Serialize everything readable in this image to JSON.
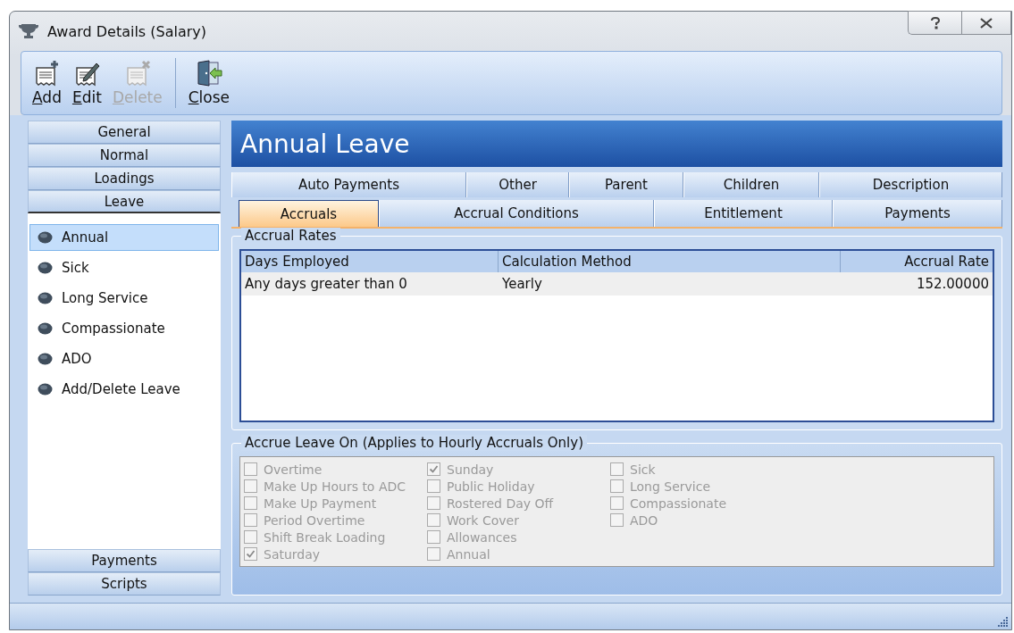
{
  "window": {
    "title": "Award Details (Salary)"
  },
  "toolbar": [
    {
      "label": "Add",
      "disabled": false,
      "kind": "add"
    },
    {
      "label": "Edit",
      "disabled": false,
      "kind": "edit"
    },
    {
      "label": "Delete",
      "disabled": true,
      "kind": "delete"
    },
    {
      "label": "Close",
      "disabled": false,
      "kind": "close"
    }
  ],
  "sidebar": {
    "sections": [
      {
        "label": "General",
        "selected": false
      },
      {
        "label": "Normal",
        "selected": false
      },
      {
        "label": "Loadings",
        "selected": false
      },
      {
        "label": "Leave",
        "selected": true
      }
    ],
    "items": [
      {
        "label": "Annual",
        "selected": true
      },
      {
        "label": "Sick",
        "selected": false
      },
      {
        "label": "Long Service",
        "selected": false
      },
      {
        "label": "Compassionate",
        "selected": false
      },
      {
        "label": "ADO",
        "selected": false
      },
      {
        "label": "Add/Delete Leave",
        "selected": false
      }
    ],
    "bottom_sections": [
      {
        "label": "Payments",
        "selected": false
      },
      {
        "label": "Scripts",
        "selected": false
      }
    ]
  },
  "header": "Annual Leave",
  "tab_rows": [
    [
      {
        "label": "Auto Payments",
        "selected": false
      },
      {
        "label": "Other",
        "selected": false
      },
      {
        "label": "Parent",
        "selected": false
      },
      {
        "label": "Children",
        "selected": false
      },
      {
        "label": "Description",
        "selected": false
      }
    ],
    [
      {
        "label": "Accruals",
        "selected": true
      },
      {
        "label": "Accrual Conditions",
        "selected": false
      },
      {
        "label": "Entitlement",
        "selected": false
      },
      {
        "label": "Payments",
        "selected": false
      }
    ]
  ],
  "accrual_rates": {
    "title": "Accrual Rates",
    "columns": [
      "Days Employed",
      "Calculation Method",
      "Accrual Rate"
    ],
    "rows": [
      [
        "Any days greater than 0",
        "Yearly",
        "152.00000"
      ]
    ]
  },
  "accrue_leave_on": {
    "title": "Accrue Leave On (Applies to Hourly Accruals Only)",
    "disabled": true,
    "columns": [
      [
        {
          "label": "Overtime",
          "checked": false
        },
        {
          "label": "Make Up Hours to ADC",
          "checked": false
        },
        {
          "label": "Make Up Payment",
          "checked": false
        },
        {
          "label": "Period Overtime",
          "checked": false
        },
        {
          "label": "Shift Break Loading",
          "checked": false
        },
        {
          "label": "Saturday",
          "checked": true
        }
      ],
      [
        {
          "label": "Sunday",
          "checked": true
        },
        {
          "label": "Public Holiday",
          "checked": false
        },
        {
          "label": "Rostered Day Off",
          "checked": false
        },
        {
          "label": "Work Cover",
          "checked": false
        },
        {
          "label": "Allowances",
          "checked": false
        },
        {
          "label": "Annual",
          "checked": false
        }
      ],
      [
        {
          "label": "Sick",
          "checked": false
        },
        {
          "label": "Long Service",
          "checked": false
        },
        {
          "label": "Compassionate",
          "checked": false
        },
        {
          "label": "ADO",
          "checked": false
        }
      ]
    ]
  }
}
